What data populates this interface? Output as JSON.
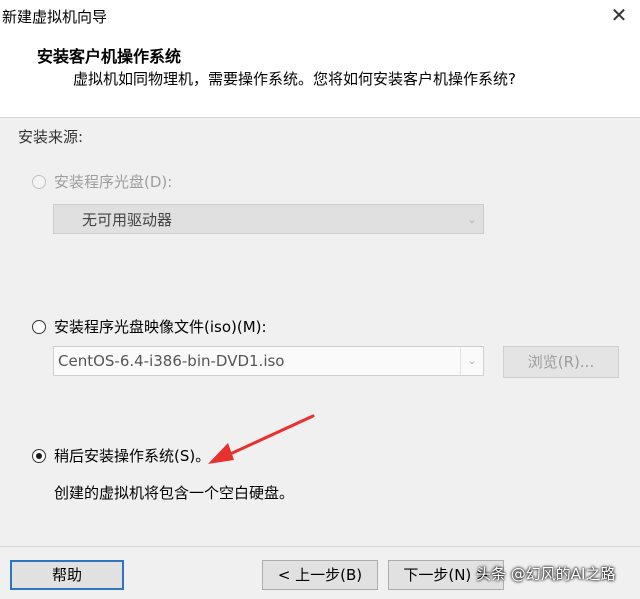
{
  "window": {
    "title": "新建虚拟机向导",
    "close": "✕"
  },
  "header": {
    "title": "安装客户机操作系统",
    "subtitle": "虚拟机如同物理机，需要操作系统。您将如何安装客户机操作系统?"
  },
  "source_label": "安装来源:",
  "options": {
    "disc": {
      "label": "安装程序光盘(D):",
      "selected": false,
      "enabled": false,
      "drive_value": "无可用驱动器"
    },
    "iso": {
      "label": "安装程序光盘映像文件(iso)(M):",
      "selected": false,
      "enabled": true,
      "file_value": "CentOS-6.4-i386-bin-DVD1.iso",
      "browse_label": "浏览(R)..."
    },
    "later": {
      "label": "稍后安装操作系统(S)。",
      "selected": true,
      "enabled": true,
      "description": "创建的虚拟机将包含一个空白硬盘。"
    }
  },
  "footer": {
    "help": "帮助",
    "back": "< 上一步(B)",
    "next": "下一步(N) >"
  },
  "watermark": "头条 @幻风的AI之路",
  "colors": {
    "annotation_arrow": "#e8312f",
    "focus_border": "#2f74c0"
  }
}
